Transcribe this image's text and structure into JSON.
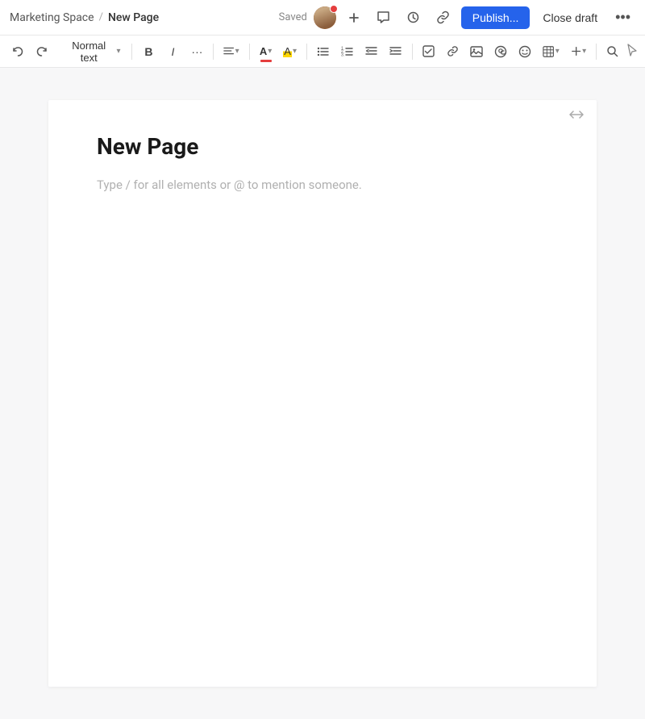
{
  "topbar": {
    "breadcrumb_space": "Marketing Space",
    "breadcrumb_separator": "/",
    "breadcrumb_page": "New Page",
    "saved_label": "Saved",
    "publish_label": "Publish...",
    "close_draft_label": "Close draft"
  },
  "toolbar": {
    "text_style_label": "Normal text",
    "bold_label": "B",
    "italic_label": "I",
    "more_label": "···",
    "align_label": "≡",
    "text_color_label": "A",
    "highlight_label": "A",
    "bullet_list_label": "≡",
    "ordered_list_label": "≡",
    "outdent_label": "⇤",
    "indent_label": "⇥",
    "checkbox_label": "☑",
    "link_label": "🔗",
    "image_label": "🖼",
    "mention_label": "@",
    "emoji_label": "☺",
    "table_label": "⊞",
    "insert_label": "+",
    "search_label": "🔍"
  },
  "editor": {
    "page_title": "New Page",
    "placeholder": "Type / for all elements or @ to mention someone.",
    "expand_icon": "↔"
  }
}
